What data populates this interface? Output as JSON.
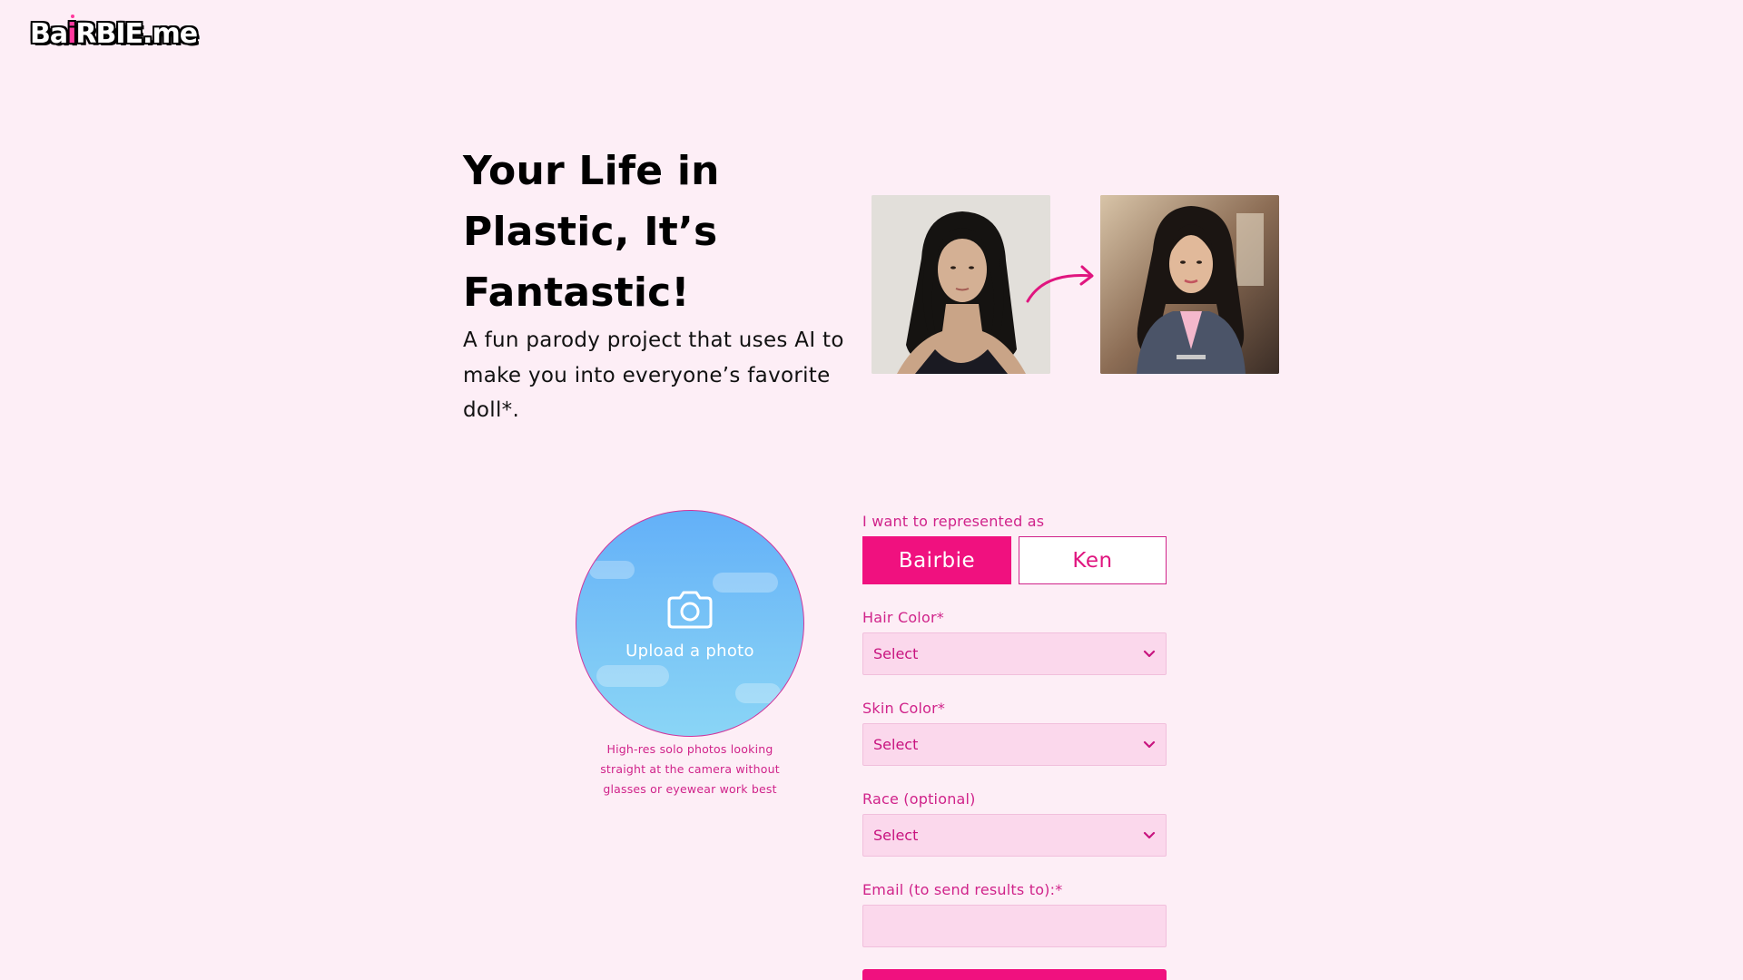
{
  "logo": {
    "part1": "Ba",
    "part2": "i",
    "part3": "RBIE.me"
  },
  "hero": {
    "title": "Your Life in Plastic, It’s Fantastic!",
    "subtitle": "A fun parody project that uses AI to make you into everyone’s favorite doll*."
  },
  "upload": {
    "label": "Upload a photo",
    "hint": "High-res solo photos looking straight at the camera without glasses or eyewear work best",
    "icon": "camera-icon"
  },
  "form": {
    "represent_label": "I want to represented as",
    "options": {
      "bairbie": "Bairbie",
      "ken": "Ken"
    },
    "selected_option": "Bairbie",
    "hair": {
      "label": "Hair Color*",
      "value": "Select"
    },
    "skin": {
      "label": "Skin Color*",
      "value": "Select"
    },
    "race": {
      "label": "Race (optional)",
      "value": "Select"
    },
    "email": {
      "label": "Email (to send results to):*",
      "value": ""
    }
  },
  "colors": {
    "background": "#fdeef6",
    "accent": "#f0117f",
    "label": "#d0238a",
    "field": "#fbd8ec"
  }
}
